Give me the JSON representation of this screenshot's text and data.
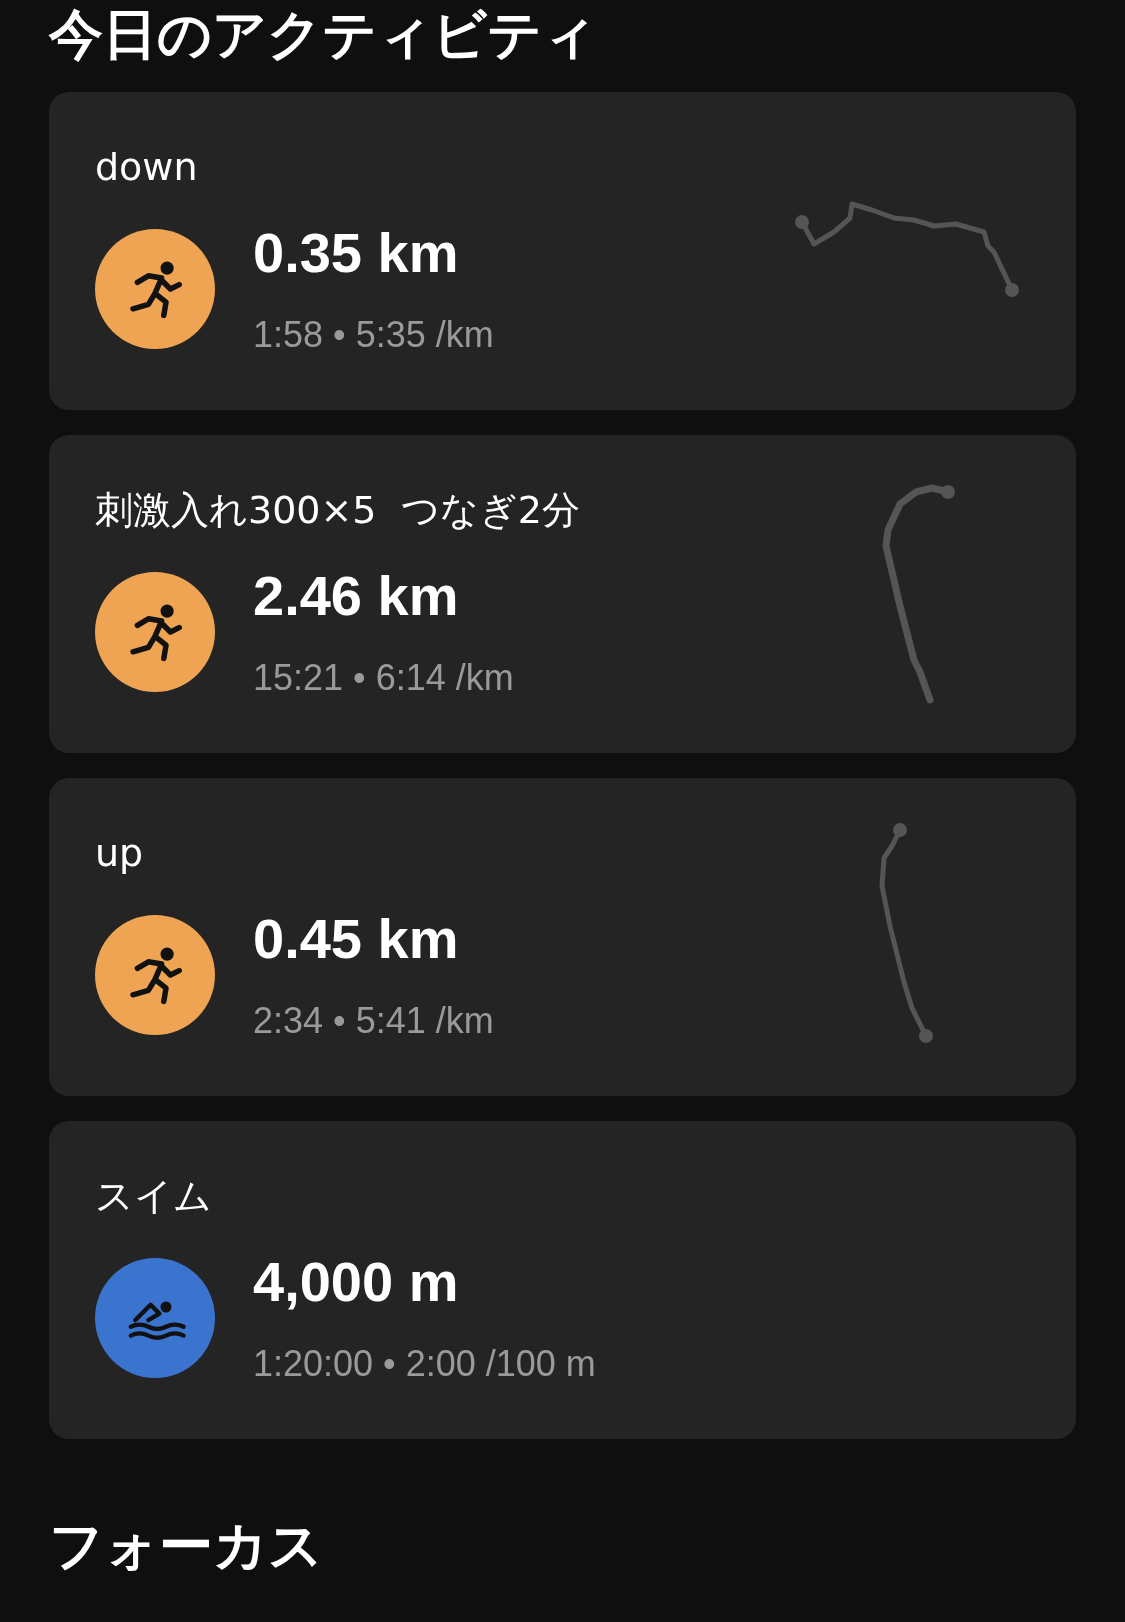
{
  "section_title": "今日のアクティビティ",
  "activities": [
    {
      "title": "down",
      "kind": "run",
      "distance": "0.35 km",
      "stats": "1:58 • 5:35 /km",
      "has_route": true
    },
    {
      "title": "刺激入れ300×5  つなぎ2分",
      "kind": "run",
      "distance": "2.46 km",
      "stats": "15:21 • 6:14 /km",
      "has_route": true
    },
    {
      "title": "up",
      "kind": "run",
      "distance": "0.45 km",
      "stats": "2:34 • 5:41 /km",
      "has_route": true
    },
    {
      "title": "スイム",
      "kind": "swim",
      "distance": "4,000 m",
      "stats": "1:20:00 • 2:00 /100 m",
      "has_route": false
    }
  ],
  "next_section_title": "フォーカス"
}
